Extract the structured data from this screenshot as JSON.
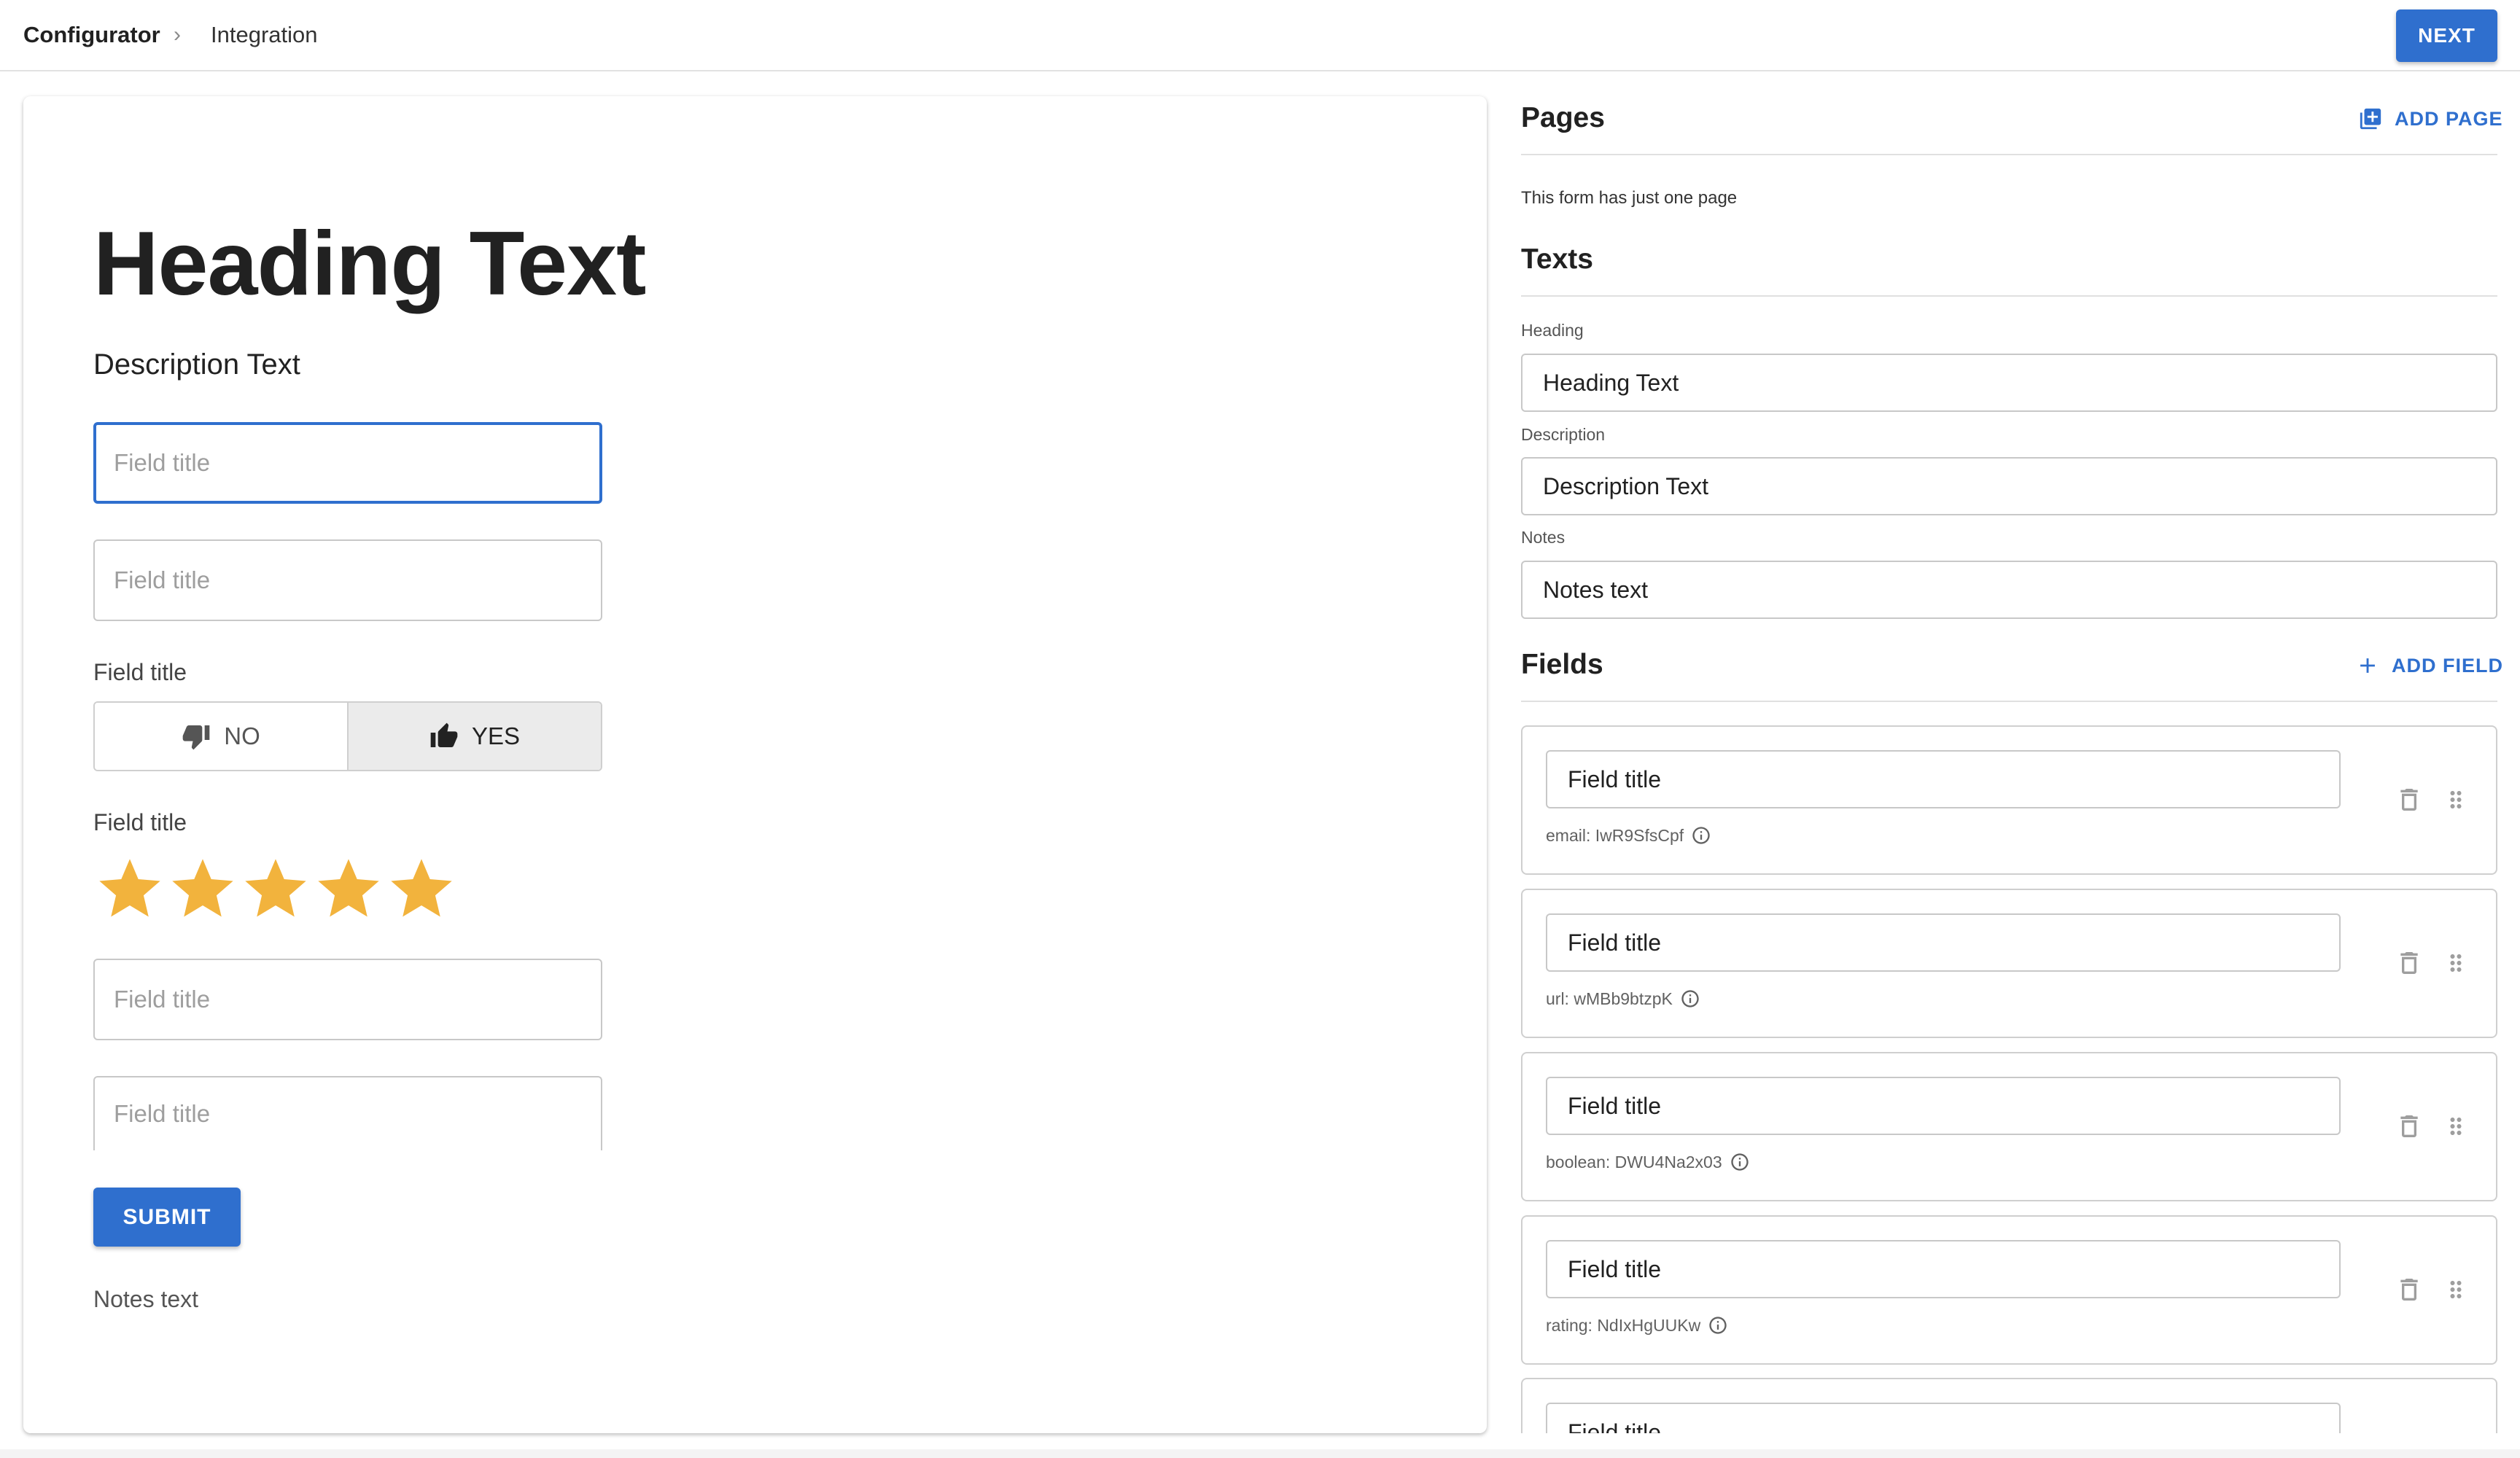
{
  "topbar": {
    "breadcrumb_root": "Configurator",
    "breadcrumb_separator": "›",
    "breadcrumb_current": "Integration",
    "next_label": "NEXT"
  },
  "preview": {
    "heading": "Heading Text",
    "description": "Description Text",
    "inputs": [
      {
        "placeholder": "Field title",
        "focused": true
      },
      {
        "placeholder": "Field title"
      },
      {
        "placeholder": "Field title"
      },
      {
        "placeholder": "Field title"
      }
    ],
    "boolean_field": {
      "label": "Field title",
      "no_label": "NO",
      "yes_label": "YES",
      "selected": "YES"
    },
    "rating_field": {
      "label": "Field title",
      "value": 5,
      "max": 5
    },
    "submit_label": "SUBMIT",
    "notes": "Notes text"
  },
  "panel": {
    "pages": {
      "title": "Pages",
      "add_label": "ADD PAGE",
      "info": "This form has just one page"
    },
    "texts": {
      "title": "Texts",
      "heading_label": "Heading",
      "heading_value": "Heading Text",
      "description_label": "Description",
      "description_value": "Description Text",
      "notes_label": "Notes",
      "notes_value": "Notes text"
    },
    "fields": {
      "title": "Fields",
      "add_label": "ADD FIELD",
      "items": [
        {
          "value": "Field title",
          "meta": "email: IwR9SfsCpf"
        },
        {
          "value": "Field title",
          "meta": "url: wMBb9btzpK"
        },
        {
          "value": "Field title",
          "meta": "boolean: DWU4Na2x03"
        },
        {
          "value": "Field title",
          "meta": "rating: NdIxHgUUKw"
        },
        {
          "value": "Field title"
        }
      ]
    }
  },
  "colors": {
    "accent": "#2f6fce",
    "star": "#f2b33d",
    "border": "#c8c8c8"
  },
  "icons": [
    "chevron-right-icon",
    "thumbs-down-icon",
    "thumbs-up-icon",
    "star-icon",
    "add-box-icon",
    "plus-icon",
    "info-icon",
    "delete-icon",
    "drag-handle-icon"
  ]
}
